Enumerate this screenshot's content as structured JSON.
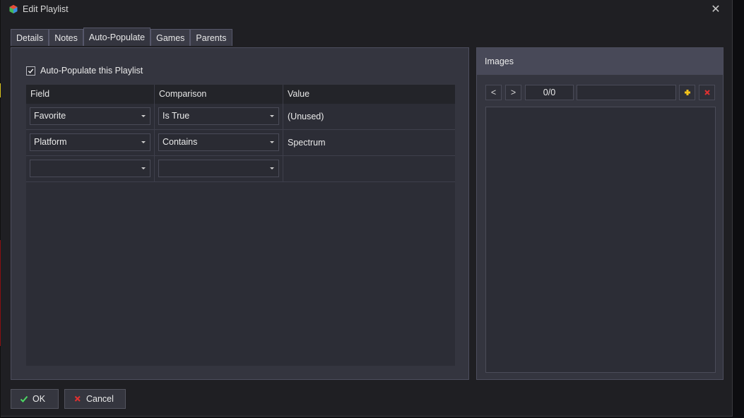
{
  "window": {
    "title": "Edit Playlist",
    "close_glyph": "✕"
  },
  "tabs": [
    {
      "label": "Details",
      "active": false
    },
    {
      "label": "Notes",
      "active": false
    },
    {
      "label": "Auto-Populate",
      "active": true
    },
    {
      "label": "Games",
      "active": false
    },
    {
      "label": "Parents",
      "active": false
    }
  ],
  "auto_populate": {
    "checkbox_label": "Auto-Populate this Playlist",
    "checked": true,
    "columns": [
      "Field",
      "Comparison",
      "Value"
    ],
    "rows": [
      {
        "field": "Favorite",
        "comparison": "Is True",
        "value": "(Unused)"
      },
      {
        "field": "Platform",
        "comparison": "Contains",
        "value": "Spectrum"
      },
      {
        "field": "",
        "comparison": "",
        "value": ""
      }
    ]
  },
  "images": {
    "title": "Images",
    "prev_label": "<",
    "next_label": ">",
    "counter": "0/0",
    "add_icon": "plus-icon",
    "remove_icon": "x-icon"
  },
  "buttons": {
    "ok_label": "OK",
    "cancel_label": "Cancel"
  },
  "colors": {
    "background": "#1f1f23",
    "panel": "#34353f",
    "ok_check": "#4cd964",
    "cancel_x": "#e03030",
    "add_plus": "#f3c21b"
  }
}
